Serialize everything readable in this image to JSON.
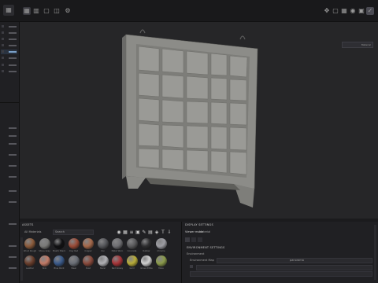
{
  "materials_panel": {
    "title": "ASSETS",
    "filter_label": "All Materials",
    "search_placeholder": "Search",
    "materials": [
      {
        "name": "Wood Rough",
        "color": "#8a5a3a"
      },
      {
        "name": "Stone Grey",
        "color": "#7a7a78"
      },
      {
        "name": "Plastic Black",
        "color": "#111113"
      },
      {
        "name": "Clay Red",
        "color": "#9a4a36"
      },
      {
        "name": "Copper",
        "color": "#a4684a"
      },
      {
        "name": "Iron",
        "color": "#55565a"
      },
      {
        "name": "Metal Worn",
        "color": "#6e6e72"
      },
      {
        "name": "Concrete",
        "color": "#5a5a5c"
      },
      {
        "name": "Rubber",
        "color": "#2e2e30"
      },
      {
        "name": "Chrome",
        "color": "#9c9ca2"
      },
      {
        "name": "Leather",
        "color": "#6a3e2c"
      },
      {
        "name": "Skin",
        "color": "#c27a66"
      },
      {
        "name": "Blue Paint",
        "color": "#3a5a8a"
      },
      {
        "name": "Steel",
        "color": "#6a6e76"
      },
      {
        "name": "Rust",
        "color": "#8a4a3c"
      },
      {
        "name": "Silver",
        "color": "#b0b0b4"
      },
      {
        "name": "Red Glossy",
        "color": "#a83438"
      },
      {
        "name": "Gold",
        "color": "#b8ac38"
      },
      {
        "name": "Gloss White",
        "color": "#d0d0d0"
      },
      {
        "name": "Moss",
        "color": "#8a9a4a"
      }
    ]
  },
  "display_panel": {
    "title": "DISPLAY SETTINGS",
    "tabs": [
      "Viewer mode",
      "Material"
    ],
    "section_title": "ENVIRONMENT SETTINGS",
    "environment_label": "Environment",
    "env_map_label": "Environment Map",
    "env_map_value": "panorama"
  },
  "viewport": {
    "shading_mode": "Material"
  },
  "colors": {
    "accent": "#7aa0c8",
    "panel_bg": "#202023",
    "viewport_bg": "#262628"
  }
}
